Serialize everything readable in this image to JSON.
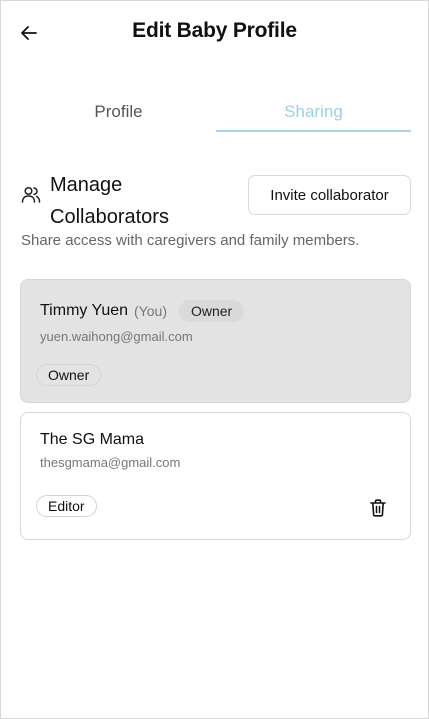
{
  "header": {
    "title": "Edit Baby Profile",
    "back_icon": "arrow-left-icon"
  },
  "tabs": [
    {
      "label": "Profile",
      "active": false
    },
    {
      "label": "Sharing",
      "active": true
    }
  ],
  "section": {
    "icon": "users-icon",
    "title": "Manage Collaborators",
    "invite_label": "Invite collaborator",
    "subtitle": "Share access with caregivers and family members."
  },
  "collaborators": [
    {
      "name": "Timmy Yuen",
      "you_tag": "(You)",
      "inline_badge": "Owner",
      "email": "yuen.waihong@gmail.com",
      "role": "Owner"
    },
    {
      "name": "The SG Mama",
      "email": "thesgmama@gmail.com",
      "role": "Editor",
      "delete_icon": "trash-icon"
    }
  ],
  "colors": {
    "active_tab": "#9fcfe6",
    "owner_card_bg": "#e3e3e3"
  }
}
